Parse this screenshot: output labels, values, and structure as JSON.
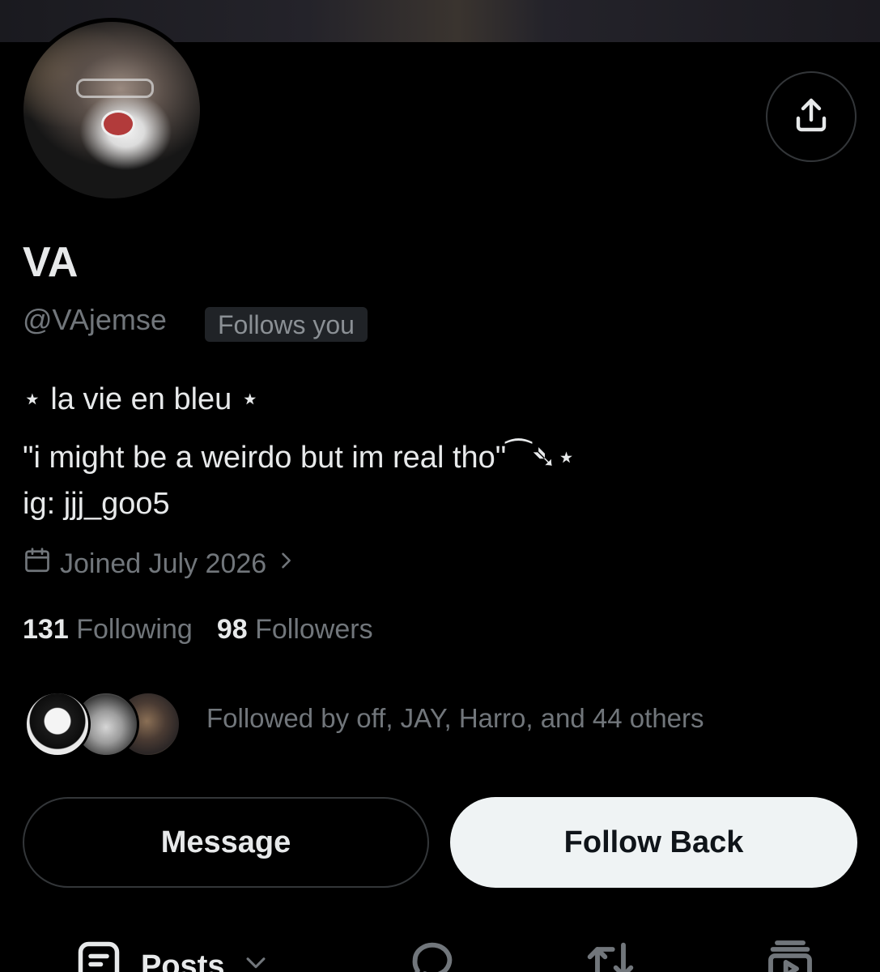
{
  "profile": {
    "name": "VA",
    "handle": "@VAjemse",
    "follows_you": "Follows you",
    "bio_line1": "⋆ la vie en bleu ⋆",
    "bio_line2": "\"i might be a weirdo but im real tho\"⁀➴⋆",
    "bio_line3": "ig: jjj_goo5",
    "joined": "Joined July 2026",
    "following_count": "131",
    "following_label": "Following",
    "followers_count": "98",
    "followers_label": "Followers",
    "followed_by": "Followed by off, JAY, Harro, and 44 others"
  },
  "actions": {
    "message": "Message",
    "follow_back": "Follow Back"
  },
  "tabs": {
    "posts": "Posts"
  },
  "colors": {
    "background": "#000000",
    "primary_text": "#e7e9ea",
    "secondary_text": "#71767b",
    "badge_bg": "#202327",
    "border": "#333639",
    "follow_button_bg": "#eff3f4"
  },
  "icons": [
    "share-icon",
    "calendar-icon",
    "chevron-right-icon",
    "posts-icon",
    "chevron-down-icon",
    "replies-icon",
    "reposts-icon",
    "media-icon"
  ]
}
